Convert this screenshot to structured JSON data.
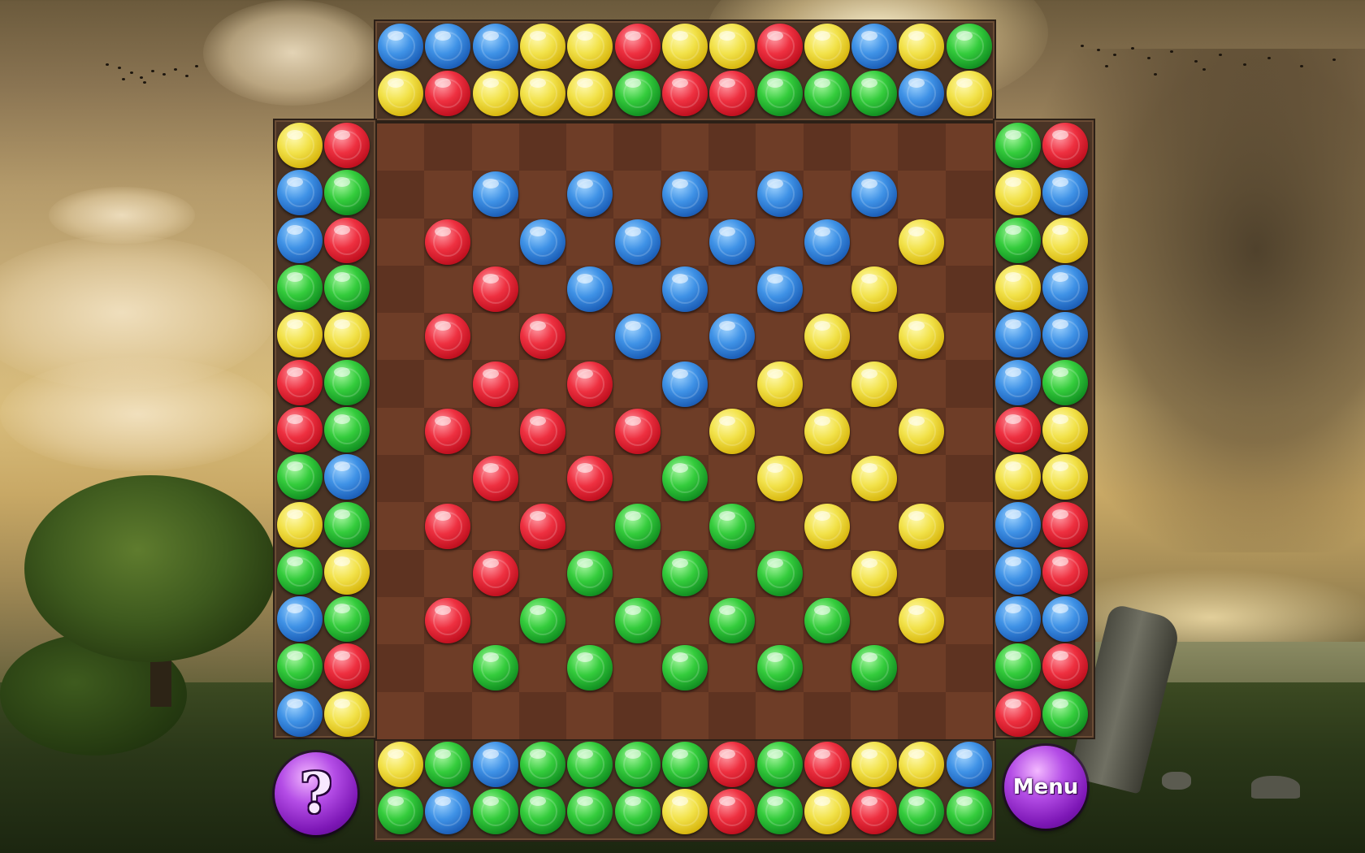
{
  "buttons": {
    "help_label": "?",
    "menu_label": "Menu"
  },
  "colors": {
    "blue": "#3f92e6",
    "yellow": "#f2e24a",
    "red": "#ee3040",
    "green": "#34cc3c",
    "board_light": "#6e3d27",
    "board_dark": "#5e3321",
    "frame": "#4a3425",
    "button_purple": "#b44de6"
  },
  "top_tray": [
    [
      "blue",
      "blue",
      "blue",
      "yellow",
      "yellow",
      "red",
      "yellow",
      "yellow",
      "red",
      "yellow",
      "blue",
      "yellow",
      "green"
    ],
    [
      "yellow",
      "red",
      "yellow",
      "yellow",
      "yellow",
      "green",
      "red",
      "red",
      "green",
      "green",
      "green",
      "blue",
      "yellow"
    ]
  ],
  "bottom_tray": [
    [
      "yellow",
      "green",
      "blue",
      "green",
      "green",
      "green",
      "green",
      "red",
      "green",
      "red",
      "yellow",
      "yellow",
      "blue"
    ],
    [
      "green",
      "blue",
      "green",
      "green",
      "green",
      "green",
      "yellow",
      "red",
      "green",
      "yellow",
      "red",
      "green",
      "green"
    ]
  ],
  "left_tray": [
    [
      "yellow",
      "red"
    ],
    [
      "blue",
      "green"
    ],
    [
      "blue",
      "red"
    ],
    [
      "green",
      "green"
    ],
    [
      "yellow",
      "yellow"
    ],
    [
      "red",
      "green"
    ],
    [
      "red",
      "green"
    ],
    [
      "green",
      "blue"
    ],
    [
      "yellow",
      "green"
    ],
    [
      "green",
      "yellow"
    ],
    [
      "blue",
      "green"
    ],
    [
      "green",
      "red"
    ],
    [
      "blue",
      "yellow"
    ]
  ],
  "right_tray": [
    [
      "green",
      "red"
    ],
    [
      "yellow",
      "blue"
    ],
    [
      "green",
      "yellow"
    ],
    [
      "yellow",
      "blue"
    ],
    [
      "blue",
      "blue"
    ],
    [
      "blue",
      "green"
    ],
    [
      "red",
      "yellow"
    ],
    [
      "yellow",
      "yellow"
    ],
    [
      "blue",
      "red"
    ],
    [
      "blue",
      "red"
    ],
    [
      "blue",
      "blue"
    ],
    [
      "green",
      "red"
    ],
    [
      "red",
      "green"
    ]
  ],
  "board": [
    [
      "",
      "",
      "",
      "",
      "",
      "",
      "",
      "",
      "",
      "",
      "",
      "",
      ""
    ],
    [
      "",
      "",
      "blue",
      "",
      "blue",
      "",
      "blue",
      "",
      "blue",
      "",
      "blue",
      "",
      ""
    ],
    [
      "",
      "red",
      "",
      "blue",
      "",
      "blue",
      "",
      "blue",
      "",
      "blue",
      "",
      "yellow",
      ""
    ],
    [
      "",
      "",
      "red",
      "",
      "blue",
      "",
      "blue",
      "",
      "blue",
      "",
      "yellow",
      "",
      ""
    ],
    [
      "",
      "red",
      "",
      "red",
      "",
      "blue",
      "",
      "blue",
      "",
      "yellow",
      "",
      "yellow",
      ""
    ],
    [
      "",
      "",
      "red",
      "",
      "red",
      "",
      "blue",
      "",
      "yellow",
      "",
      "yellow",
      "",
      ""
    ],
    [
      "",
      "red",
      "",
      "red",
      "",
      "red",
      "",
      "yellow",
      "",
      "yellow",
      "",
      "yellow",
      ""
    ],
    [
      "",
      "",
      "red",
      "",
      "red",
      "",
      "green",
      "",
      "yellow",
      "",
      "yellow",
      "",
      ""
    ],
    [
      "",
      "red",
      "",
      "red",
      "",
      "green",
      "",
      "green",
      "",
      "yellow",
      "",
      "yellow",
      ""
    ],
    [
      "",
      "",
      "red",
      "",
      "green",
      "",
      "green",
      "",
      "green",
      "",
      "yellow",
      "",
      ""
    ],
    [
      "",
      "red",
      "",
      "green",
      "",
      "green",
      "",
      "green",
      "",
      "green",
      "",
      "yellow",
      ""
    ],
    [
      "",
      "",
      "green",
      "",
      "green",
      "",
      "green",
      "",
      "green",
      "",
      "green",
      "",
      ""
    ],
    [
      "",
      "",
      "",
      "",
      "",
      "",
      "",
      "",
      "",
      "",
      "",
      "",
      ""
    ]
  ]
}
